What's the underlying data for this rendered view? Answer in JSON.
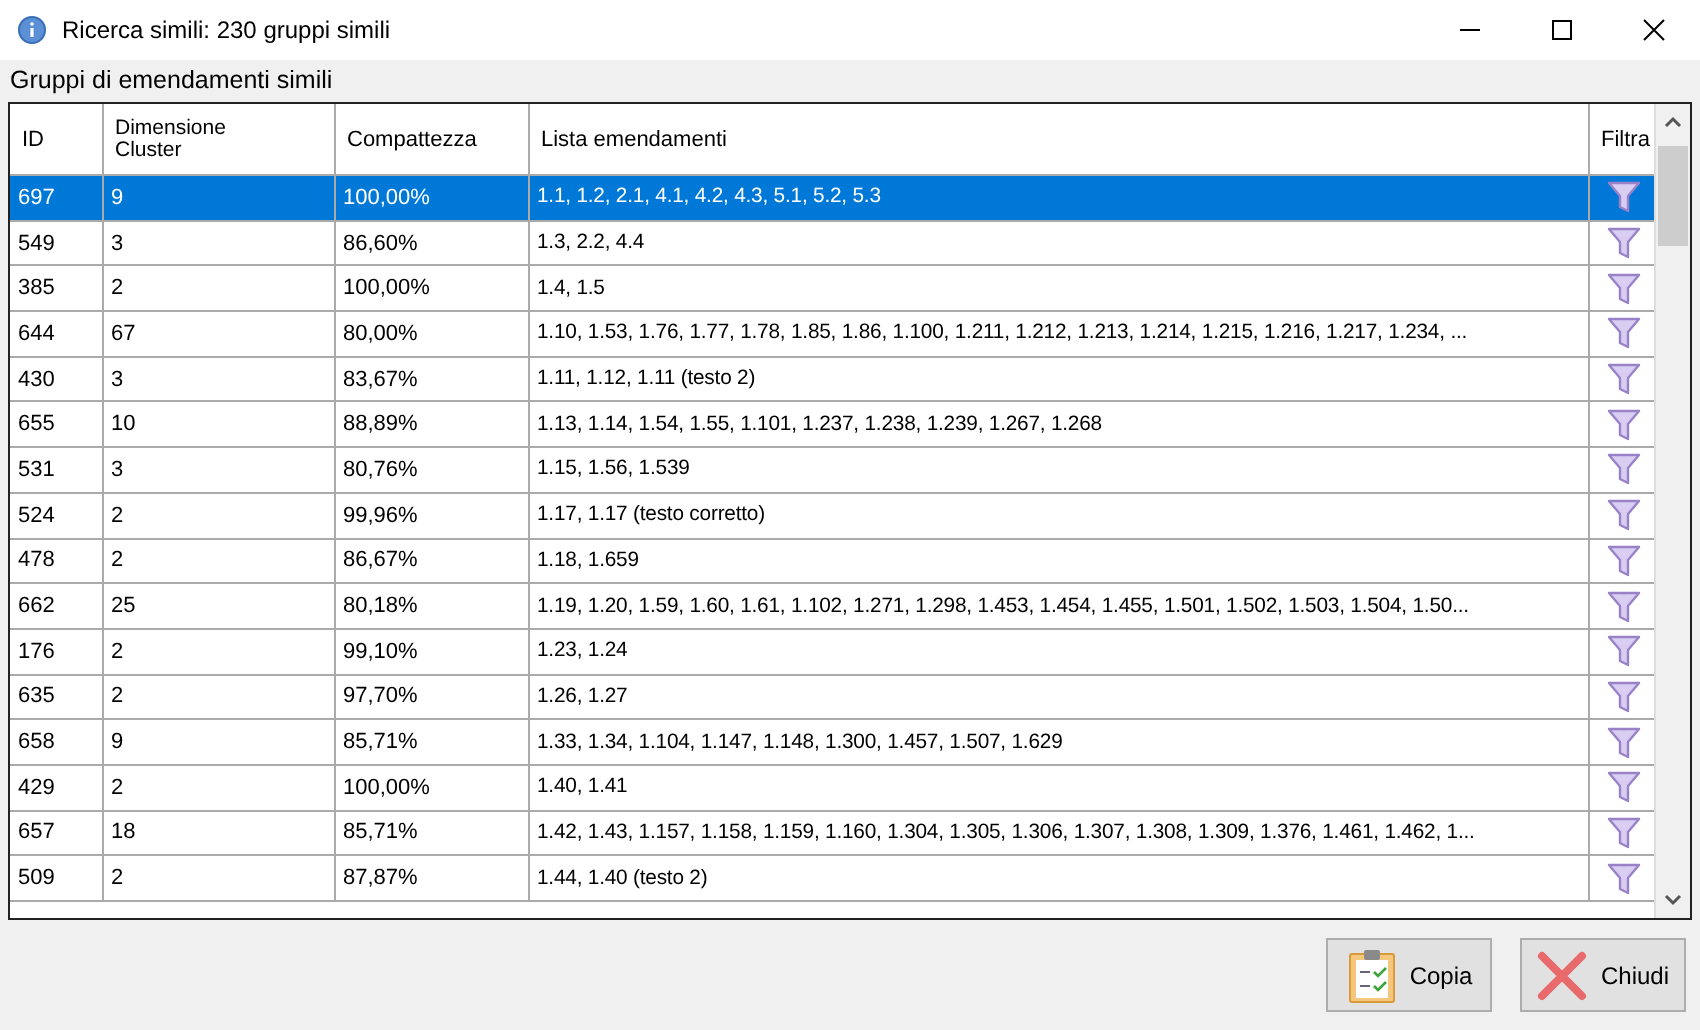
{
  "window": {
    "title": "Ricerca simili: 230 gruppi simili"
  },
  "group_label": "Gruppi di emendamenti simili",
  "table": {
    "columns": [
      "ID",
      "Dimensione\nCluster",
      "Compattezza",
      "Lista emendamenti",
      "Filtra"
    ],
    "rows": [
      {
        "id": "697",
        "size": "9",
        "compactness": "100,00%",
        "list": "1.1, 1.2, 2.1, 4.1, 4.2, 4.3, 5.1, 5.2, 5.3",
        "selected": true
      },
      {
        "id": "549",
        "size": "3",
        "compactness": "86,60%",
        "list": "1.3, 2.2, 4.4",
        "selected": false
      },
      {
        "id": "385",
        "size": "2",
        "compactness": "100,00%",
        "list": "1.4, 1.5",
        "selected": false
      },
      {
        "id": "644",
        "size": "67",
        "compactness": "80,00%",
        "list": "1.10, 1.53, 1.76, 1.77, 1.78, 1.85, 1.86, 1.100, 1.211, 1.212, 1.213, 1.214, 1.215, 1.216, 1.217, 1.234, ...",
        "selected": false
      },
      {
        "id": "430",
        "size": "3",
        "compactness": "83,67%",
        "list": "1.11, 1.12, 1.11 (testo 2)",
        "selected": false
      },
      {
        "id": "655",
        "size": "10",
        "compactness": "88,89%",
        "list": "1.13, 1.14, 1.54, 1.55, 1.101, 1.237, 1.238, 1.239, 1.267, 1.268",
        "selected": false
      },
      {
        "id": "531",
        "size": "3",
        "compactness": "80,76%",
        "list": "1.15, 1.56, 1.539",
        "selected": false
      },
      {
        "id": "524",
        "size": "2",
        "compactness": "99,96%",
        "list": "1.17, 1.17 (testo corretto)",
        "selected": false
      },
      {
        "id": "478",
        "size": "2",
        "compactness": "86,67%",
        "list": "1.18, 1.659",
        "selected": false
      },
      {
        "id": "662",
        "size": "25",
        "compactness": "80,18%",
        "list": "1.19, 1.20, 1.59, 1.60, 1.61, 1.102, 1.271, 1.298, 1.453, 1.454, 1.455, 1.501, 1.502, 1.503, 1.504, 1.50...",
        "selected": false
      },
      {
        "id": "176",
        "size": "2",
        "compactness": "99,10%",
        "list": "1.23, 1.24",
        "selected": false
      },
      {
        "id": "635",
        "size": "2",
        "compactness": "97,70%",
        "list": "1.26, 1.27",
        "selected": false
      },
      {
        "id": "658",
        "size": "9",
        "compactness": "85,71%",
        "list": "1.33, 1.34, 1.104, 1.147, 1.148, 1.300, 1.457, 1.507, 1.629",
        "selected": false
      },
      {
        "id": "429",
        "size": "2",
        "compactness": "100,00%",
        "list": "1.40, 1.41",
        "selected": false
      },
      {
        "id": "657",
        "size": "18",
        "compactness": "85,71%",
        "list": "1.42, 1.43, 1.157, 1.158, 1.159, 1.160, 1.304, 1.305, 1.306, 1.307, 1.308, 1.309, 1.376, 1.461, 1.462, 1...",
        "selected": false
      },
      {
        "id": "509",
        "size": "2",
        "compactness": "87,87%",
        "list": "1.44, 1.40 (testo 2)",
        "selected": false
      }
    ]
  },
  "buttons": [
    {
      "label": "Copia",
      "kind": "copy"
    },
    {
      "label": "Chiudi",
      "kind": "close"
    }
  ]
}
